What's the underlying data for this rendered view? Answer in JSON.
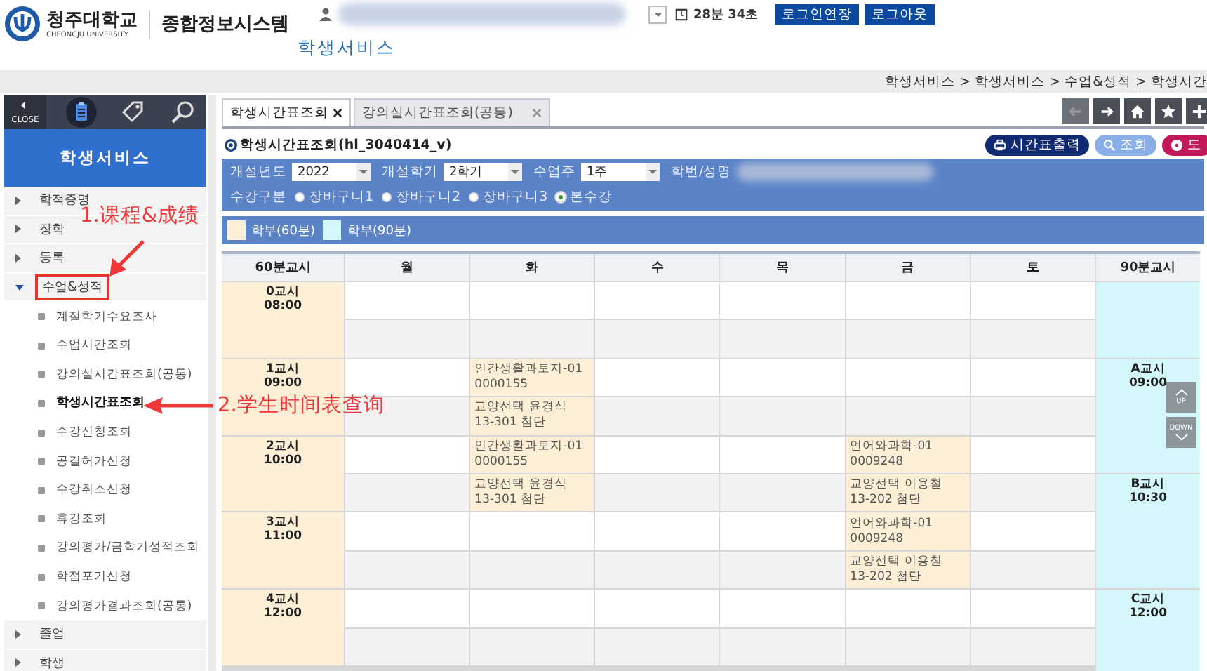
{
  "header": {
    "university": "청주대학교",
    "university_en": "CHEONGJU UNIVERSITY",
    "system": "종합정보시스템",
    "subtitle": "학생서비스",
    "timer": "28분 34초",
    "buttons": [
      "로그인연장",
      "로그아웃"
    ]
  },
  "breadcrumb": "학생서비스 > 학생서비스 > 수업&성적 > 학생시간",
  "sidebar": {
    "close_label": "CLOSE",
    "title": "학생서비스",
    "items": [
      {
        "label": "학적증명",
        "expanded": false
      },
      {
        "label": "장학",
        "expanded": false
      },
      {
        "label": "등록",
        "expanded": false
      },
      {
        "label": "수업&성적",
        "expanded": true,
        "children": [
          {
            "label": "계절학기수요조사",
            "selected": false
          },
          {
            "label": "수업시간조회",
            "selected": false
          },
          {
            "label": "강의실시간표조회(공통)",
            "selected": false
          },
          {
            "label": "학생시간표조회",
            "selected": true
          },
          {
            "label": "수강신청조회",
            "selected": false
          },
          {
            "label": "공결허가신청",
            "selected": false
          },
          {
            "label": "수강취소신청",
            "selected": false
          },
          {
            "label": "휴강조회",
            "selected": false
          },
          {
            "label": "강의평가/금학기성적조회",
            "selected": false
          },
          {
            "label": "학점포기신청",
            "selected": false
          },
          {
            "label": "강의평가결과조회(공통)",
            "selected": false
          }
        ]
      },
      {
        "label": "졸업",
        "expanded": false
      },
      {
        "label": "학생",
        "expanded": false
      }
    ]
  },
  "tabs": [
    {
      "label": "학생시간표조회",
      "selected": true
    },
    {
      "label": "강의실시간표조회(공통)",
      "selected": false
    }
  ],
  "nav_buttons": [
    {
      "kind": "back",
      "disabled": true
    },
    {
      "kind": "forward",
      "disabled": false
    },
    {
      "kind": "home",
      "disabled": false
    },
    {
      "kind": "favorite",
      "disabled": false
    },
    {
      "kind": "add",
      "disabled": false
    }
  ],
  "page": {
    "title": "학생시간표조회(hl_3040414_v)",
    "actions": [
      {
        "kind": "print",
        "label": "시간표출력"
      },
      {
        "kind": "search",
        "label": "조회"
      },
      {
        "kind": "help",
        "label": "도"
      }
    ]
  },
  "filters": {
    "fields": [
      {
        "label": "개설년도",
        "value": "2022"
      },
      {
        "label": "개설학기",
        "value": "2학기"
      },
      {
        "label": "수업주",
        "value": "1주"
      }
    ],
    "student_label": "학번/성명",
    "radio_label": "수강구분",
    "radios": [
      {
        "label": "장바구니1",
        "selected": false
      },
      {
        "label": "장바구니2",
        "selected": false
      },
      {
        "label": "장바구니3",
        "selected": false
      },
      {
        "label": "본수강",
        "selected": true
      }
    ]
  },
  "legend": [
    {
      "label": "학부(60분)",
      "color": "#fdefd6"
    },
    {
      "label": "학부(90분)",
      "color": "#d4f7fc"
    }
  ],
  "timetable": {
    "columns": [
      "60분교시",
      "월",
      "화",
      "수",
      "목",
      "금",
      "토",
      "90분교시"
    ],
    "periods": [
      {
        "label": "0교시",
        "time": "08:00",
        "halves": [
          [
            {
              "kind": "empty"
            },
            {
              "kind": "empty"
            },
            {
              "kind": "empty"
            },
            {
              "kind": "empty"
            },
            {
              "kind": "empty"
            },
            {
              "kind": "empty"
            }
          ],
          [
            {
              "kind": "empty"
            },
            {
              "kind": "empty"
            },
            {
              "kind": "empty"
            },
            {
              "kind": "empty"
            },
            {
              "kind": "empty"
            },
            {
              "kind": "empty"
            }
          ]
        ]
      },
      {
        "label": "1교시",
        "time": "09:00",
        "halves": [
          [
            {
              "kind": "empty"
            },
            {
              "kind": "class",
              "lines": [
                "인간생활과토지-01",
                "0000155"
              ]
            },
            {
              "kind": "empty"
            },
            {
              "kind": "empty"
            },
            {
              "kind": "empty"
            },
            {
              "kind": "empty"
            }
          ],
          [
            {
              "kind": "empty"
            },
            {
              "kind": "class",
              "lines": [
                "교양선택 윤경식",
                "13-301 첨단"
              ]
            },
            {
              "kind": "empty"
            },
            {
              "kind": "empty"
            },
            {
              "kind": "empty"
            },
            {
              "kind": "empty"
            }
          ]
        ]
      },
      {
        "label": "2교시",
        "time": "10:00",
        "halves": [
          [
            {
              "kind": "empty"
            },
            {
              "kind": "class",
              "lines": [
                "인간생활과토지-01",
                "0000155"
              ]
            },
            {
              "kind": "empty"
            },
            {
              "kind": "empty"
            },
            {
              "kind": "class",
              "lines": [
                "언어와과학-01",
                "0009248"
              ]
            },
            {
              "kind": "empty"
            }
          ],
          [
            {
              "kind": "empty"
            },
            {
              "kind": "class",
              "lines": [
                "교양선택 윤경식",
                "13-301 첨단"
              ]
            },
            {
              "kind": "empty"
            },
            {
              "kind": "empty"
            },
            {
              "kind": "class",
              "lines": [
                "교양선택 이용철",
                "13-202 첨단"
              ]
            },
            {
              "kind": "empty"
            }
          ]
        ]
      },
      {
        "label": "3교시",
        "time": "11:00",
        "halves": [
          [
            {
              "kind": "empty"
            },
            {
              "kind": "empty"
            },
            {
              "kind": "empty"
            },
            {
              "kind": "empty"
            },
            {
              "kind": "class",
              "lines": [
                "언어와과학-01",
                "0009248"
              ]
            },
            {
              "kind": "empty"
            }
          ],
          [
            {
              "kind": "empty"
            },
            {
              "kind": "empty"
            },
            {
              "kind": "empty"
            },
            {
              "kind": "empty"
            },
            {
              "kind": "class",
              "lines": [
                "교양선택 이용철",
                "13-202 첨단"
              ]
            },
            {
              "kind": "empty"
            }
          ]
        ]
      },
      {
        "label": "4교시",
        "time": "12:00",
        "halves": [
          [
            {
              "kind": "empty"
            },
            {
              "kind": "empty"
            },
            {
              "kind": "empty"
            },
            {
              "kind": "empty"
            },
            {
              "kind": "empty"
            },
            {
              "kind": "empty"
            }
          ],
          [
            {
              "kind": "empty"
            },
            {
              "kind": "empty"
            },
            {
              "kind": "empty"
            },
            {
              "kind": "empty"
            },
            {
              "kind": "empty"
            },
            {
              "kind": "empty"
            }
          ]
        ]
      }
    ],
    "ninety": [
      {
        "label": "A교시",
        "time": "09:00"
      },
      {
        "label": "B교시",
        "time": "10:30"
      },
      {
        "label": "C교시",
        "time": "12:00"
      }
    ]
  },
  "scroll_buttons": [
    "UP",
    "DOWN"
  ],
  "annotations": [
    {
      "text": "1.课程&成绩"
    },
    {
      "text": "2.学生时间表查询"
    }
  ]
}
